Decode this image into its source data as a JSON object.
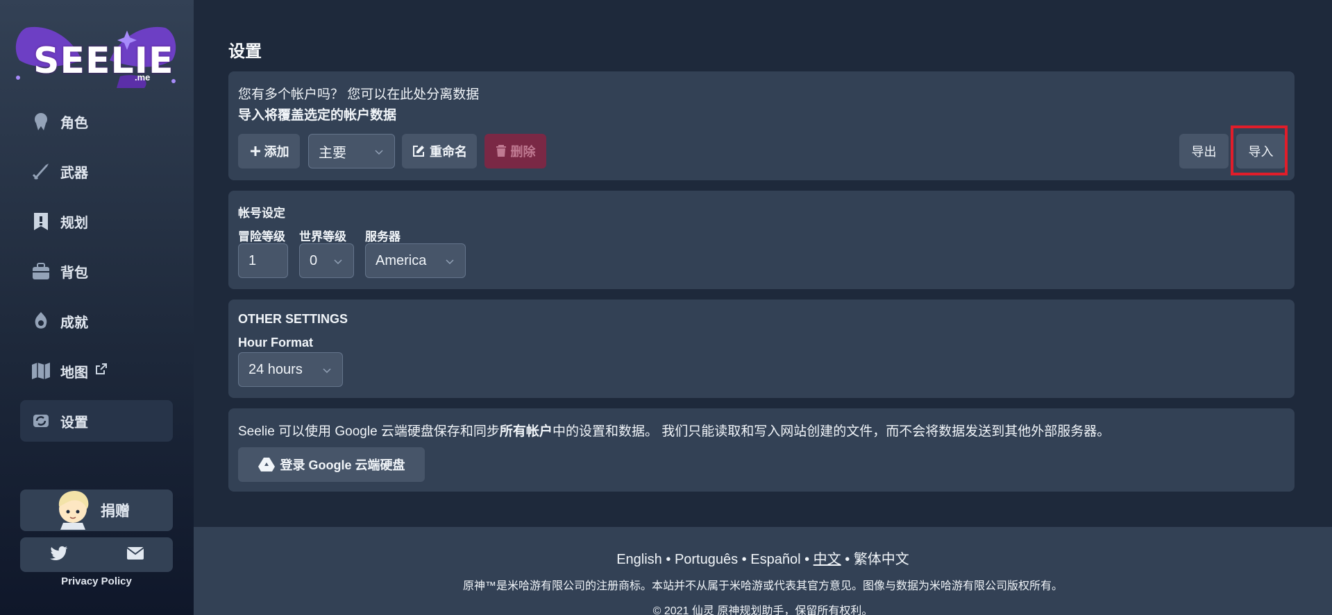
{
  "brand": {
    "logo_text": "SEELIE",
    "logo_sub": ".me",
    "accent": "#7c3aed"
  },
  "sidebar": {
    "items": [
      {
        "label": "角色",
        "icon": "character-icon"
      },
      {
        "label": "武器",
        "icon": "weapon-icon"
      },
      {
        "label": "规划",
        "icon": "planner-icon"
      },
      {
        "label": "背包",
        "icon": "inventory-icon"
      },
      {
        "label": "成就",
        "icon": "achievement-icon"
      },
      {
        "label": "地图",
        "icon": "map-icon",
        "external": true
      },
      {
        "label": "设置",
        "icon": "settings-icon",
        "active": true
      }
    ],
    "donate_label": "捐赠",
    "privacy_label": "Privacy Policy"
  },
  "page": {
    "title": "设置"
  },
  "accounts": {
    "question": "您有多个帐户吗？ 您可以在此处分离数据",
    "warning": "导入将覆盖选定的帐户数据",
    "add_label": "添加",
    "selected_account": "主要",
    "rename_label": "重命名",
    "delete_label": "删除",
    "export_label": "导出",
    "import_label": "导入"
  },
  "account_settings": {
    "title": "帐号设定",
    "adventure_rank_label": "冒险等级",
    "adventure_rank_value": "1",
    "world_level_label": "世界等级",
    "world_level_value": "0",
    "server_label": "服务器",
    "server_value": "America"
  },
  "other_settings": {
    "title": "OTHER SETTINGS",
    "hour_format_label": "Hour Format",
    "hour_format_value": "24 hours"
  },
  "gdrive": {
    "text_before": "Seelie 可以使用 Google 云端硬盘保存和同步",
    "text_bold": "所有帐户",
    "text_after": "中的设置和数据。 我们只能读取和写入网站创建的文件，而不会将数据发送到其他外部服务器。",
    "login_label": "登录 Google 云端硬盘"
  },
  "footer": {
    "lang_en": "English",
    "lang_pt": "Português",
    "lang_es": "Español",
    "lang_zh": "中文",
    "lang_zhtw": "繁体中文",
    "sep": "•",
    "legal": "原神™是米哈游有限公司的注册商标。本站并不从属于米哈游或代表其官方意见。图像与数据为米哈游有限公司版权所有。",
    "copyright": "© 2021 仙灵 原神规划助手，保留所有权利。"
  }
}
